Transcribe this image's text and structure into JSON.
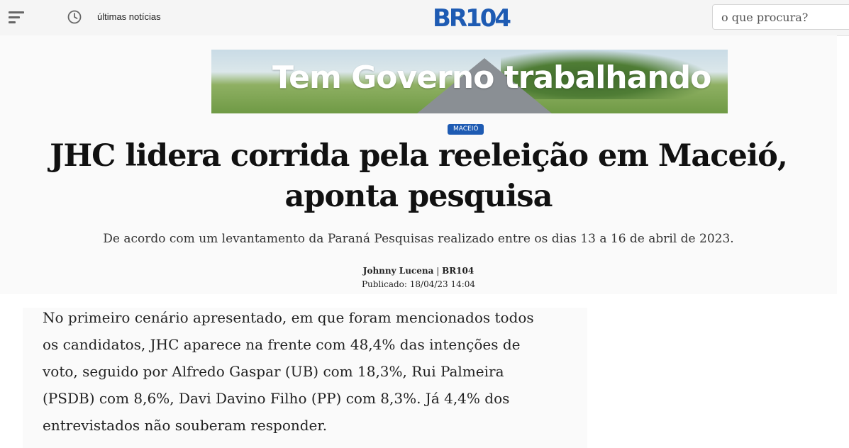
{
  "header": {
    "latest_news_label": "últimas notícias",
    "logo_prefix": "BR",
    "logo_number": "104",
    "search_placeholder": "o que procura?"
  },
  "banner": {
    "text": "Tem Governo trabalhando"
  },
  "article": {
    "category": "MACEIÓ",
    "title": "JHC lidera corrida pela reeleição em Maceió, aponta pesquisa",
    "subtitle": "De acordo com um levantamento da Paraná Pesquisas realizado entre os dias 13 a 16 de abril de 2023.",
    "author": "Johnny Lucena",
    "source": "BR104",
    "published": "Publicado: 18/04/23 14:04",
    "paragraph": "No primeiro cenário apresentado, em que foram mencionados todos os candidatos, JHC aparece na frente com 48,4% das intenções de voto, seguido por Alfredo Gaspar (UB) com 18,3%, Rui Palmeira (PSDB) com 8,6%, Davi Davino Filho (PP) com 8,3%. Já 4,4% dos entrevistados não souberam responder."
  },
  "colors": {
    "brand": "#1e5bb3"
  }
}
